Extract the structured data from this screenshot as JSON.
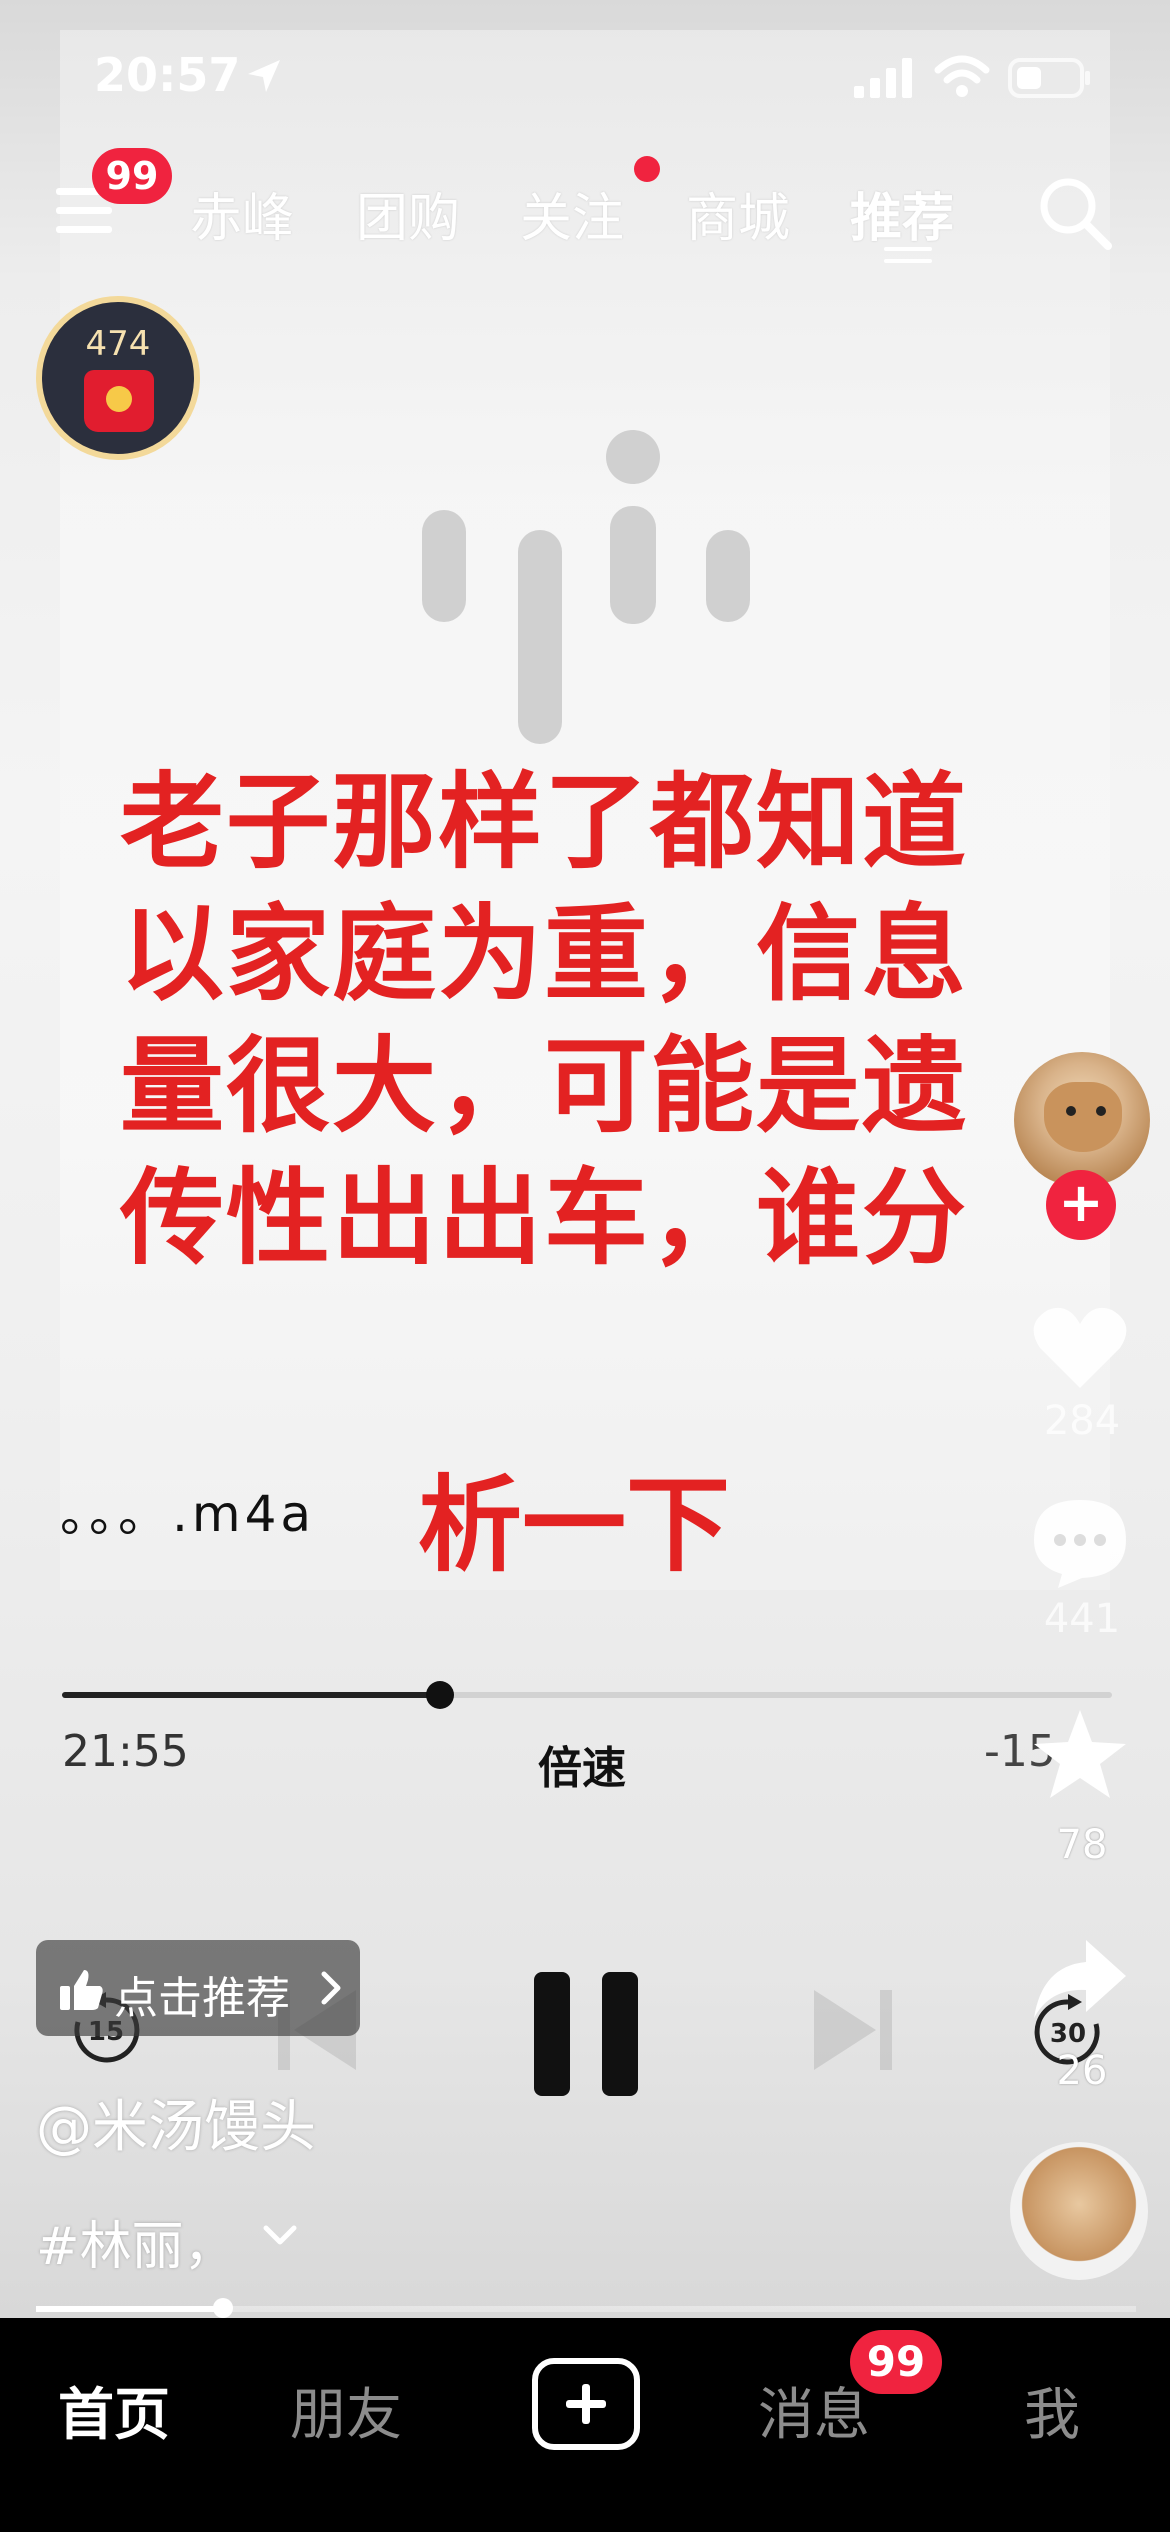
{
  "status_bar": {
    "time": "20:57"
  },
  "top_nav": {
    "menu_badge": "99",
    "tabs": [
      "赤峰",
      "团购",
      "关注",
      "商城",
      "推荐"
    ],
    "active_tab": "推荐"
  },
  "red_packet": {
    "count": "474"
  },
  "caption": {
    "lines": [
      "老子那样了都知道",
      "以家庭为重，信息",
      "量很大，可能是遗",
      "传性出出车，谁分"
    ],
    "last_line": "析一下"
  },
  "audio": {
    "filename": "。。。.m4a",
    "elapsed": "21:55",
    "speed_label": "倍速",
    "remaining": "-15",
    "progress": 0.36
  },
  "recommend": {
    "label": "点击推荐"
  },
  "post": {
    "author": "@米汤馒头",
    "tag": "#林丽，"
  },
  "video_progress": 0.17,
  "rail": {
    "likes": "284",
    "comments": "441",
    "favorites": "78",
    "shares": "26"
  },
  "bottom_tabs": {
    "home": "首页",
    "friends": "朋友",
    "messages": "消息",
    "me": "我",
    "messages_badge": "99"
  },
  "colors": {
    "accent": "#f0233f",
    "caption": "#e32222"
  },
  "icons": [
    "location-arrow-icon",
    "signal-icon",
    "wifi-icon",
    "battery-icon",
    "menu-icon",
    "search-icon",
    "red-packet-icon",
    "thumb-up-icon",
    "chevron-right-icon",
    "pause-icon",
    "skip-back-15-icon",
    "skip-forward-30-icon",
    "heart-icon",
    "comment-icon",
    "star-icon",
    "share-icon",
    "plus-icon",
    "chevron-down-icon"
  ]
}
